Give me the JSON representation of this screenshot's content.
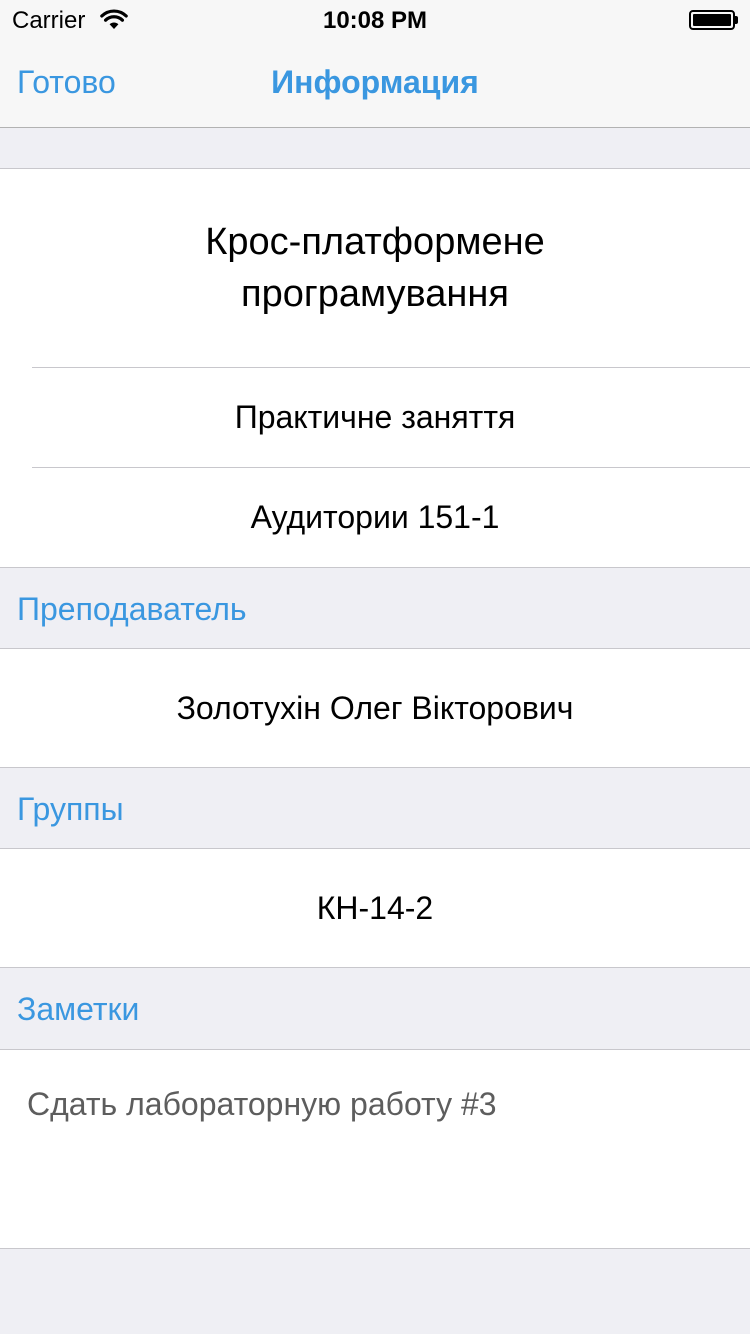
{
  "status_bar": {
    "carrier": "Carrier",
    "time": "10:08 PM",
    "wifi_icon": "wifi-icon",
    "battery_icon": "battery-icon"
  },
  "nav": {
    "done_label": "Готово",
    "title": "Информация"
  },
  "details": {
    "subject": "Крос-платформене програмування",
    "lesson_type": "Практичне заняття",
    "room": "Аудитории 151-1"
  },
  "teacher": {
    "header": "Преподаватель",
    "name": "Золотухін Олег Вікторович"
  },
  "groups": {
    "header": "Группы",
    "value": "КН-14-2"
  },
  "notes": {
    "header": "Заметки",
    "text": "Сдать лабораторную работу #3"
  },
  "colors": {
    "accent": "#3a97e0",
    "background": "#efeff4",
    "separator": "#c8c7cc"
  }
}
